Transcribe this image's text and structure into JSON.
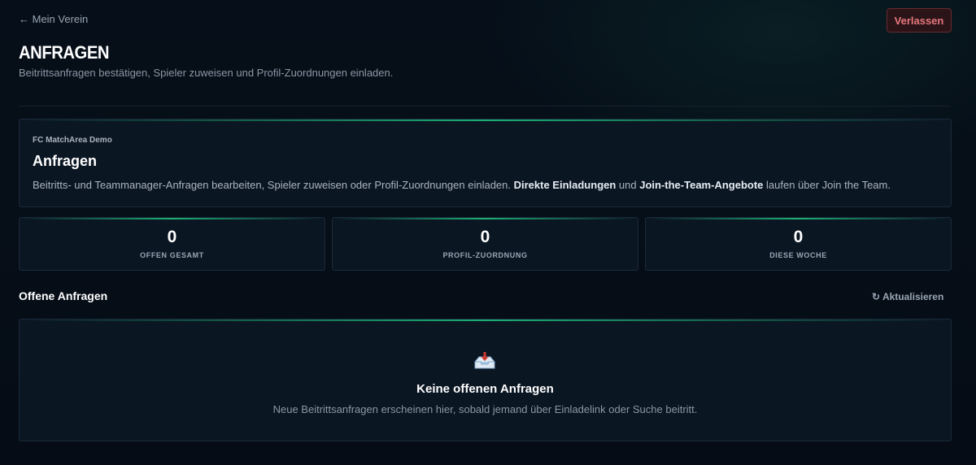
{
  "header": {
    "back_label": "← Mein Verein",
    "leave_label": "Verlassen",
    "title": "ANFRAGEN",
    "subtitle": "Beitrittsanfragen bestätigen, Spieler zuweisen und Profil-Zuordnungen einladen."
  },
  "club_card": {
    "club_name": "FC MatchArea Demo",
    "title": "Anfragen",
    "description_part1": "Beitritts- und Teammanager-Anfragen bearbeiten, Spieler zuweisen oder Profil-Zuordnungen einladen. ",
    "description_bold1": "Direkte Einladungen",
    "description_part2": " und ",
    "description_bold2": "Join-the-Team-Angebote",
    "description_part3": " laufen über Join the Team."
  },
  "stats": [
    {
      "value": "0",
      "label": "OFFEN GESAMT"
    },
    {
      "value": "0",
      "label": "PROFIL-ZUORDNUNG"
    },
    {
      "value": "0",
      "label": "DIESE WOCHE"
    }
  ],
  "requests_section": {
    "title": "Offene Anfragen",
    "refresh_label": "↻ Aktualisieren"
  },
  "empty_state": {
    "icon": "inbox-tray-icon",
    "title": "Keine offenen Anfragen",
    "description": "Neue Beitrittsanfragen erscheinen hier, sobald jemand über Einladelink oder Suche beitritt."
  },
  "colors": {
    "background": "#050d16",
    "card": "#0b1623",
    "accent_green": "#1ec882",
    "danger": "#e8787d"
  }
}
